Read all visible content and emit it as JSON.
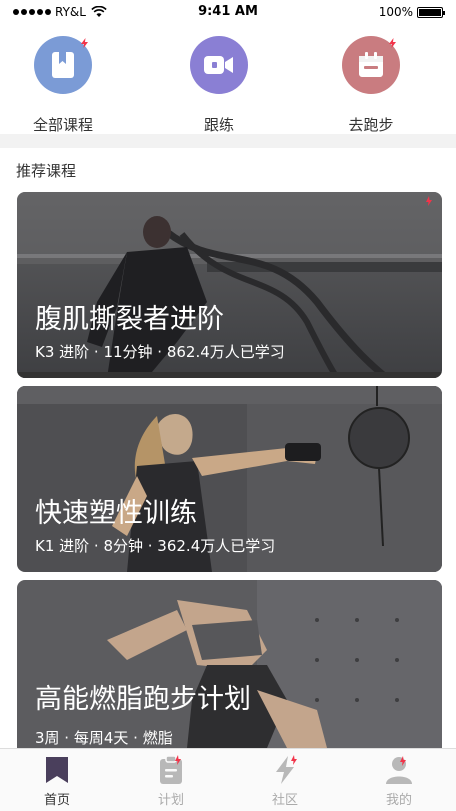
{
  "status_bar": {
    "carrier": "RY&L",
    "time": "9:41 AM",
    "battery": "100%"
  },
  "quick_nav": [
    {
      "label": "全部课程",
      "icon": "book-icon",
      "color": "#7b9bd6"
    },
    {
      "label": "跟练",
      "icon": "video-camera-icon",
      "color": "#8a7fd4"
    },
    {
      "label": "去跑步",
      "icon": "calendar-icon",
      "color": "#c97c80"
    }
  ],
  "section": {
    "title": "推荐课程"
  },
  "courses": [
    {
      "title": "腹肌撕裂者进阶",
      "meta": "K3 进阶 · 11分钟 · 862.4万人已学习"
    },
    {
      "title": "快速塑性训练",
      "meta": "K1 进阶 · 8分钟 · 362.4万人已学习"
    },
    {
      "title": "高能燃脂跑步计划",
      "meta": "3周 · 每周4天 · 燃脂"
    }
  ],
  "tab_bar": [
    {
      "label": "首页",
      "icon": "bookmark-icon",
      "active": true
    },
    {
      "label": "计划",
      "icon": "clipboard-icon",
      "active": false
    },
    {
      "label": "社区",
      "icon": "lightning-icon",
      "active": false
    },
    {
      "label": "我的",
      "icon": "user-icon",
      "active": false
    }
  ],
  "colors": {
    "badge": "#f2344a",
    "active_tab_icon": "#4a3f5c",
    "inactive_tab_icon": "#b8b8b8"
  }
}
